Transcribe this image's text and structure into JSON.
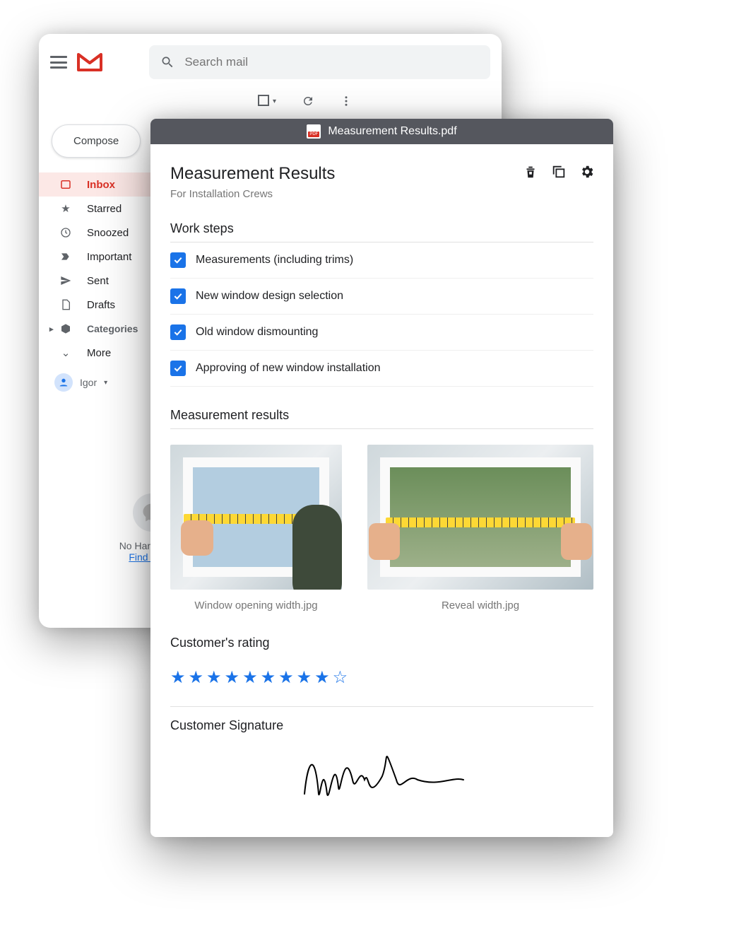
{
  "gmail": {
    "search_placeholder": "Search mail",
    "compose_label": "Compose",
    "sidebar": [
      {
        "label": "Inbox",
        "icon": "inbox",
        "active": true
      },
      {
        "label": "Starred",
        "icon": "star"
      },
      {
        "label": "Snoozed",
        "icon": "clock"
      },
      {
        "label": "Important",
        "icon": "important"
      },
      {
        "label": "Sent",
        "icon": "send"
      },
      {
        "label": "Drafts",
        "icon": "draft"
      },
      {
        "label": "Categories",
        "icon": "tag",
        "bold": true
      },
      {
        "label": "More",
        "icon": "chevron"
      }
    ],
    "user_name": "Igor",
    "hangouts_text": "No Hangouts c",
    "hangouts_link": "Find some"
  },
  "pdf": {
    "file_name": "Measurement Results.pdf",
    "title": "Measurement Results",
    "subtitle": "For Installation Crews",
    "sections": {
      "work_steps_title": "Work steps",
      "work_steps": [
        "Measurements (including trims)",
        "New window design selection",
        "Old window dismounting",
        "Approving of new window installation"
      ],
      "results_title": "Measurement results",
      "images": [
        {
          "caption": "Window opening width.jpg"
        },
        {
          "caption": "Reveal width.jpg"
        }
      ],
      "rating_title": "Customer's rating",
      "rating_value": 9,
      "rating_max": 10,
      "signature_title": "Customer Signature"
    }
  }
}
